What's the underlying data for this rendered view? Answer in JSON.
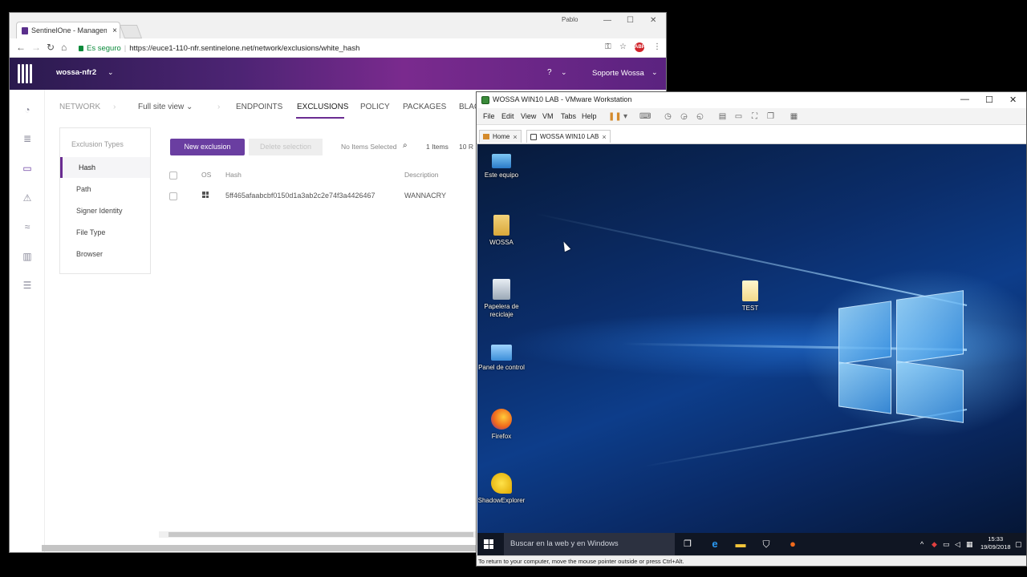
{
  "chrome": {
    "tab_title": "SentinelOne - Managem",
    "tab_close": "×",
    "profile": "Pablo",
    "win_min": "—",
    "win_max": "☐",
    "win_close": "✕",
    "url_secure": "Es seguro",
    "url": "https://euce1-110-nfr.sentinelone.net/network/exclusions/white_hash",
    "back": "←",
    "forward": "→",
    "reload": "↻",
    "home": "⌂",
    "key_icon": "⚿",
    "star_icon": "☆",
    "abp": "ABP",
    "menu_icon": "⋮"
  },
  "s1": {
    "site_name": "wossa-nfr2",
    "help": "?",
    "user": "Soporte Wossa",
    "caret": "⌄",
    "nav": {
      "network": "NETWORK",
      "site_view": "Full site view ⌄",
      "endpoints": "ENDPOINTS",
      "exclusions": "EXCLUSIONS",
      "policy": "POLICY",
      "packages": "PACKAGES",
      "blacklist": "BLAC"
    },
    "exclusion_types_title": "Exclusion Types",
    "exclusion_types": [
      "Hash",
      "Path",
      "Signer Identity",
      "File Type",
      "Browser"
    ],
    "new_exclusion": "New exclusion",
    "delete_selection": "Delete selection",
    "no_items_selected": "No Items Selected",
    "items_count": "1 Items",
    "per_page": "10 R",
    "table": {
      "headers": {
        "os": "OS",
        "hash": "Hash",
        "description": "Description"
      },
      "rows": [
        {
          "hash": "5ff465afaabcbf0150d1a3ab2c2e74f3a4426467",
          "description": "WANNACRY"
        }
      ]
    }
  },
  "vmware": {
    "title": "WOSSA WIN10 LAB - VMware Workstation",
    "menu": [
      "File",
      "Edit",
      "View",
      "VM",
      "Tabs",
      "Help"
    ],
    "tabs": {
      "home": "Home",
      "vm": "WOSSA WIN10 LAB"
    },
    "status": "To return to your computer, move the mouse pointer outside or press Ctrl+Alt.",
    "ctl_min": "—",
    "ctl_max": "☐",
    "ctl_close": "✕"
  },
  "desktop": {
    "icons": {
      "este_equipo": "Este equipo",
      "wossa": "WOSSA",
      "papelera": "Papelera de reciclaje",
      "panel": "Panel de control",
      "firefox": "Firefox",
      "shadow": "ShadowExplorer",
      "test": "TEST"
    },
    "taskbar": {
      "search_placeholder": "Buscar en la web y en Windows",
      "time": "15:33",
      "date": "19/09/2018"
    }
  },
  "colors": {
    "s1_purple": "#6a3ea1",
    "s1_header": "#4d2474",
    "desktop_blue": "#0d3d8a",
    "taskbar": "#101623"
  }
}
